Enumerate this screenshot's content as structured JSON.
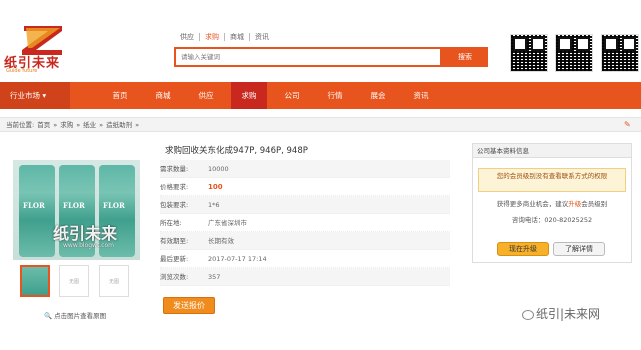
{
  "header": {
    "logo_text": "纸引未来",
    "logo_subtitle": "Guide future",
    "search_tabs": [
      "供应",
      "求购",
      "商城",
      "资讯"
    ],
    "active_search_tab": "求购",
    "search_placeholder": "请输入关键词",
    "search_button": "搜索"
  },
  "nav": {
    "category": "行业市场",
    "items": [
      "首页",
      "商城",
      "供应",
      "求购",
      "公司",
      "行情",
      "展会",
      "资讯"
    ],
    "active": "求购"
  },
  "breadcrumb": {
    "label": "当前位置:",
    "items": [
      "首页",
      "求购",
      "纸业",
      "造纸助剂"
    ]
  },
  "product": {
    "title": "求购回收关东化成947P, 946P, 948P",
    "image_watermark": "纸引未来",
    "image_watermark_url": "www.blogwt.com",
    "thumb_placeholder": "无图",
    "zoom_hint": "点击图片查看原图",
    "fields": [
      {
        "label": "需求数量:",
        "value": "10000"
      },
      {
        "label": "价格要求:",
        "value": "100"
      },
      {
        "label": "包装要求:",
        "value": "1*6"
      },
      {
        "label": "所在地:",
        "value": "广东省深圳市"
      },
      {
        "label": "有效期至:",
        "value": "长期有效"
      },
      {
        "label": "最后更新:",
        "value": "2017-07-17 17:14"
      },
      {
        "label": "浏览次数:",
        "value": "357"
      }
    ],
    "send_button": "发送报价"
  },
  "company_panel": {
    "title": "公司基本资料信息",
    "notice": "您的会员级别没有查看联系方式的权限",
    "line1_prefix": "获得更多商业机会，建议",
    "line1_link": "升级",
    "line1_suffix": "会员级别",
    "phone_label": "咨询电话：",
    "phone": "020-82025252",
    "upgrade_button": "现在升级",
    "details_button": "了解详情"
  },
  "footer_watermark": "纸引|未来网"
}
